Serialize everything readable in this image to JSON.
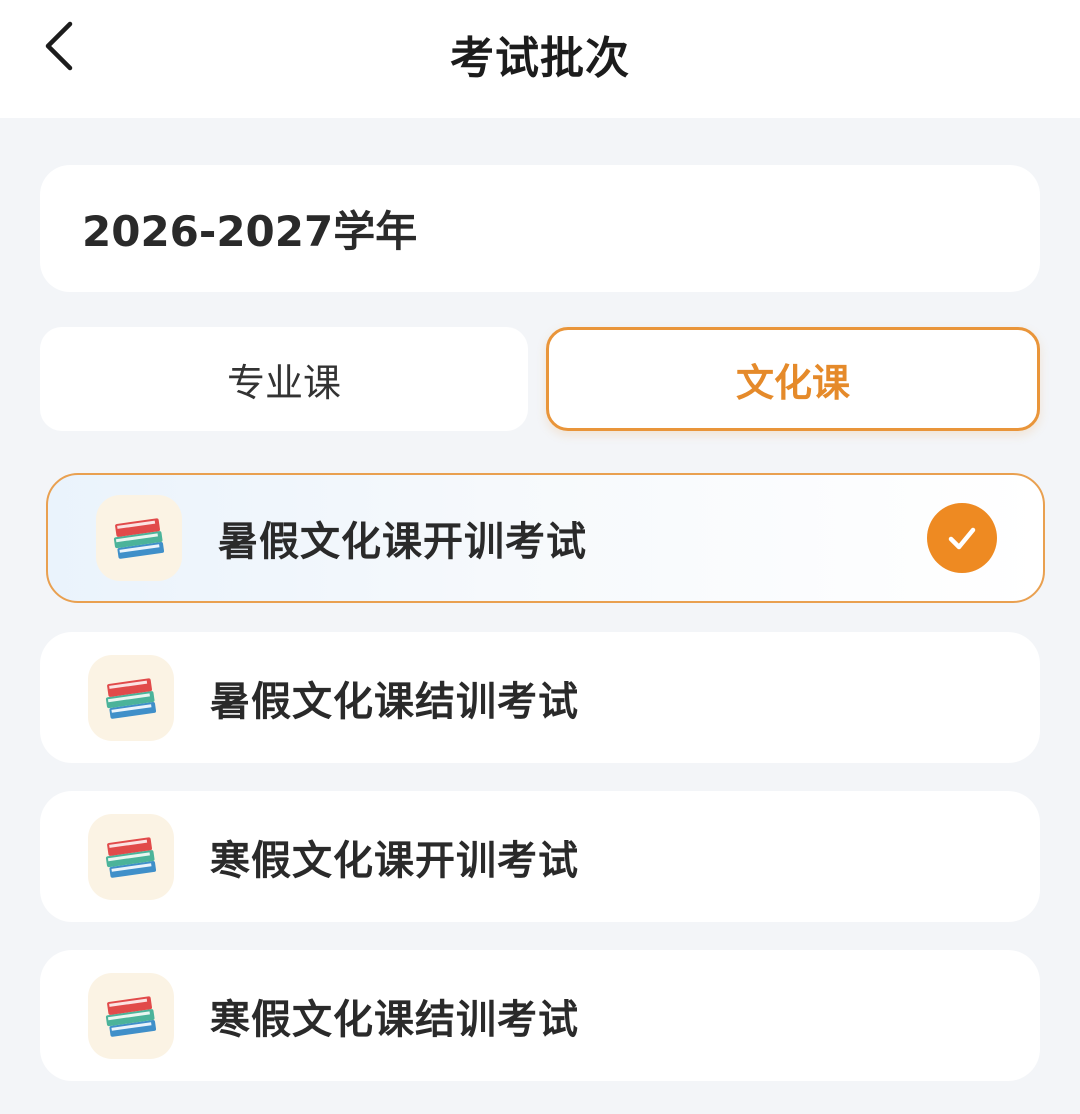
{
  "header": {
    "title": "考试批次",
    "back_icon": "chevron-left-icon"
  },
  "year": {
    "label": "2026-2027学年"
  },
  "tabs": [
    {
      "label": "专业课",
      "selected": false
    },
    {
      "label": "文化课",
      "selected": true
    }
  ],
  "exams": [
    {
      "label": "暑假文化课开训考试",
      "icon": "books-icon",
      "selected": true
    },
    {
      "label": "暑假文化课结训考试",
      "icon": "books-icon",
      "selected": false
    },
    {
      "label": "寒假文化课开训考试",
      "icon": "books-icon",
      "selected": false
    },
    {
      "label": "寒假文化课结训考试",
      "icon": "books-icon",
      "selected": false
    }
  ],
  "colors": {
    "accent": "#ee8a22",
    "background": "#f3f5f8",
    "card": "#ffffff"
  }
}
